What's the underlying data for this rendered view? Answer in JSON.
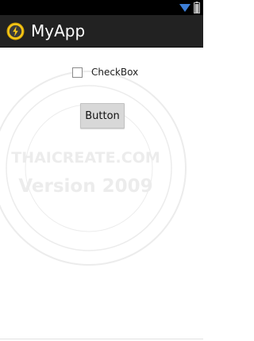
{
  "status_bar": {
    "icons": [
      "wifi-icon",
      "battery-icon"
    ],
    "background": "#000000",
    "icon_color": "#3d7fd8"
  },
  "action_bar": {
    "title": "MyApp",
    "icon": "app-lightning-icon",
    "background": "#222222",
    "icon_color": "#f5c518"
  },
  "content": {
    "checkbox": {
      "label": "CheckBox",
      "checked": false
    },
    "button": {
      "label": "Button"
    },
    "watermark": {
      "title": "THAICREATE.COM",
      "version": "Version 2009"
    }
  }
}
